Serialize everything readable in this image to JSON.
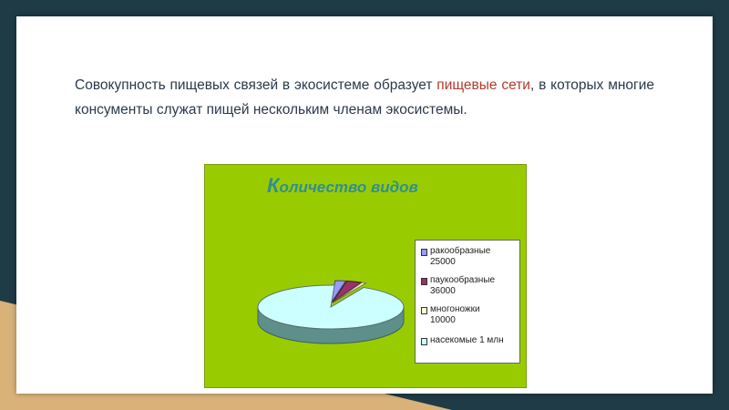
{
  "text": {
    "part1": "Совокупность пищевых связей в экосистеме образует ",
    "highlight": "пищевые сети",
    "part2": ", в которых многие консументы служат пищей нескольким членам экосистемы."
  },
  "chart_data": {
    "type": "pie",
    "title": "Количество видов",
    "title_first": "К",
    "title_rest": "оличество видов",
    "legend_position": "right",
    "series": [
      {
        "label": "ракообразные",
        "value": 25000,
        "value_text": "25000",
        "color": "#9999ff"
      },
      {
        "label": "паукообразные",
        "value": 36000,
        "value_text": "36000",
        "color": "#993366"
      },
      {
        "label": "многоножки",
        "value": 10000,
        "value_text": "10000",
        "color": "#ffffcc"
      },
      {
        "label": "насекомые 1 млн",
        "value": 1000000,
        "value_text": "",
        "color": "#ccffff"
      }
    ]
  },
  "colors": {
    "highlight": "#b23a2f",
    "chart_background": "#99cc00",
    "title_color": "#2f8f95"
  }
}
